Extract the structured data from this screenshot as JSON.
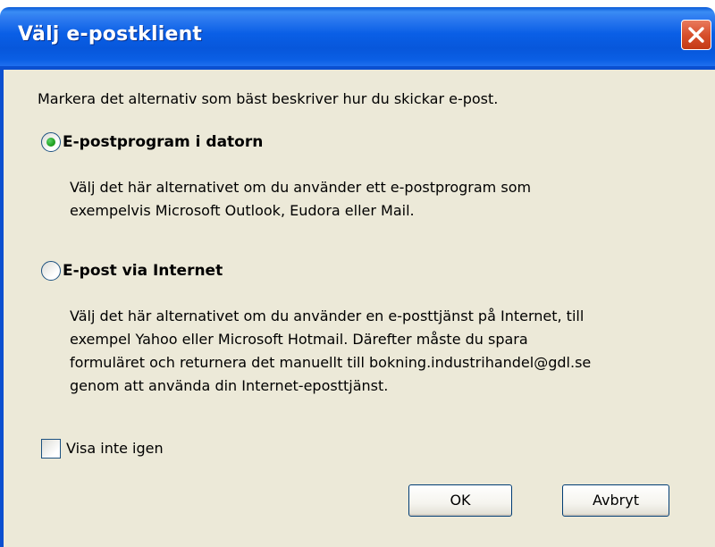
{
  "window": {
    "title": "Välj e-postklient"
  },
  "dialog": {
    "instruction": "Markera det alternativ som bäst beskriver hur du skickar e-post.",
    "options": [
      {
        "label": "E-postprogram i datorn",
        "selected": true,
        "description_lines": [
          "Välj det här alternativet om du använder ett e-postprogram som",
          "exempelvis Microsoft Outlook, Eudora eller Mail."
        ]
      },
      {
        "label": "E-post via Internet",
        "selected": false,
        "description_lines": [
          "Välj det här alternativet om du använder en e-posttjänst på Internet, till",
          "exempel Yahoo eller Microsoft Hotmail. Därefter måste du spara",
          "formuläret och returnera det manuellt till bokning.industrihandel@gdl.se",
          "genom att använda din Internet-eposttjänst."
        ]
      }
    ],
    "dont_show_again": {
      "label": "Visa inte igen",
      "checked": false
    },
    "buttons": {
      "ok": "OK",
      "cancel": "Avbryt"
    }
  },
  "colors": {
    "titlebar": "#0a5fe6",
    "dialog_background": "#ece9d8",
    "close_button": "#d7502c",
    "radio_selected": "#21a121"
  },
  "icons": {
    "close": "close-icon"
  }
}
